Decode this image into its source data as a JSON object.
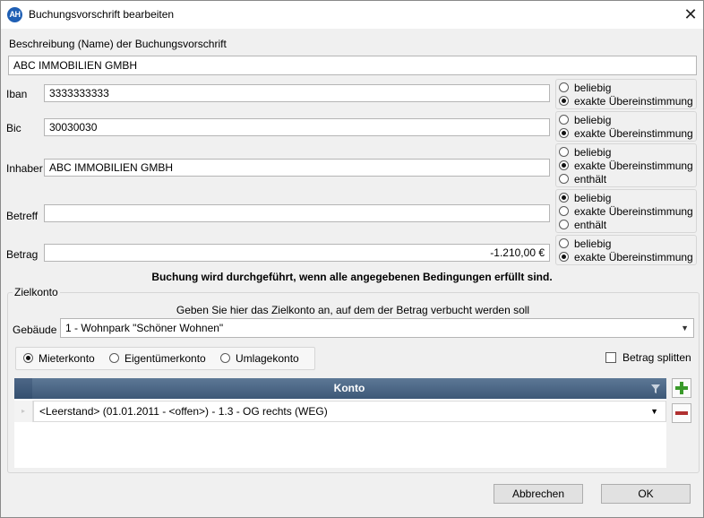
{
  "window": {
    "icon_text": "AH",
    "title": "Buchungsvorschrift bearbeiten",
    "close_glyph": "✕"
  },
  "description": {
    "label": "Beschreibung (Name) der Buchungsvorschrift",
    "value": "ABC IMMOBILIEN GMBH"
  },
  "fields": {
    "iban": {
      "label": "Iban",
      "value": "3333333333",
      "options": [
        "beliebig",
        "exakte Übereinstimmung"
      ],
      "selected": "exakte Übereinstimmung"
    },
    "bic": {
      "label": "Bic",
      "value": "30030030",
      "options": [
        "beliebig",
        "exakte Übereinstimmung"
      ],
      "selected": "exakte Übereinstimmung"
    },
    "inhaber": {
      "label": "Inhaber",
      "value": "ABC IMMOBILIEN GMBH",
      "options": [
        "beliebig",
        "exakte Übereinstimmung",
        "enthält"
      ],
      "selected": "exakte Übereinstimmung"
    },
    "betreff": {
      "label": "Betreff",
      "value": "",
      "options": [
        "beliebig",
        "exakte Übereinstimmung",
        "enthält"
      ],
      "selected": "beliebig"
    },
    "betrag": {
      "label": "Betrag",
      "value": "-1.210,00 €",
      "options": [
        "beliebig",
        "exakte Übereinstimmung"
      ],
      "selected": "exakte Übereinstimmung"
    }
  },
  "condition_note": "Buchung wird durchgeführt, wenn alle angegebenen Bedingungen erfüllt sind.",
  "zielkonto": {
    "group_label": "Zielkonto",
    "hint": "Geben Sie hier das Zielkonto an, auf dem der Betrag verbucht werden soll",
    "gebaeude_label": "Gebäude",
    "gebaeude_value": "1 - Wohnpark \"Schöner Wohnen\"",
    "account_types": [
      "Mieterkonto",
      "Eigentümerkonto",
      "Umlagekonto"
    ],
    "account_type_selected": "Mieterkonto",
    "split_label": "Betrag splitten",
    "split_checked": false,
    "grid": {
      "column_header": "Konto",
      "rows": [
        {
          "konto": "<Leerstand> (01.01.2011 - <offen>) - 1.3 - OG rechts (WEG)"
        }
      ]
    }
  },
  "buttons": {
    "cancel": "Abbrechen",
    "ok": "OK"
  },
  "colors": {
    "grid_header": "#4a6585",
    "add_icon": "#3a9a2a",
    "remove_icon": "#b03030",
    "app_icon": "#1f5fb4"
  }
}
